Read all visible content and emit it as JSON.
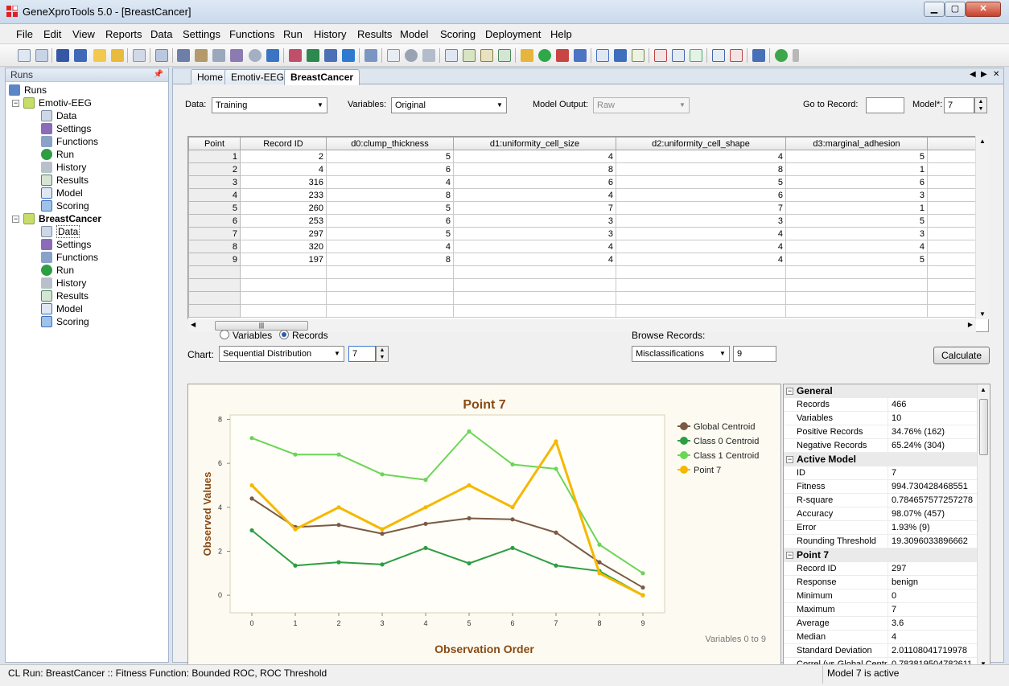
{
  "window": {
    "title": "GeneXproTools 5.0 - [BreastCancer]",
    "min_glyph": "▁",
    "max_glyph": "▢",
    "close_glyph": "✕"
  },
  "menu": [
    "File",
    "Edit",
    "View",
    "Reports",
    "Data",
    "Settings",
    "Functions",
    "Run",
    "History",
    "Results",
    "Model",
    "Scoring",
    "Deployment",
    "Help"
  ],
  "runs_panel": {
    "header": "Runs",
    "root": "Runs",
    "projects": [
      {
        "name": "Emotiv-EEG",
        "children": [
          "Data",
          "Settings",
          "Functions",
          "Run",
          "History",
          "Results",
          "Model",
          "Scoring"
        ]
      },
      {
        "name": "BreastCancer",
        "children": [
          "Data",
          "Settings",
          "Functions",
          "Run",
          "History",
          "Results",
          "Model",
          "Scoring"
        ]
      }
    ]
  },
  "tabs": [
    "Home",
    "Emotiv-EEG",
    "BreastCancer"
  ],
  "controls": {
    "data_label": "Data:",
    "data_value": "Training",
    "variables_label": "Variables:",
    "variables_value": "Original",
    "model_output_label": "Model Output:",
    "model_output_value": "Raw",
    "goto_label": "Go to Record:",
    "goto_value": "",
    "model_label": "Model*:",
    "model_value": "7"
  },
  "grid": {
    "columns": [
      "Point",
      "Record ID",
      "d0:clump_thickness",
      "d1:uniformity_cell_size",
      "d2:uniformity_cell_shape",
      "d3:marginal_adhesion"
    ],
    "rows": [
      [
        "1",
        "2",
        "5",
        "4",
        "4",
        "5"
      ],
      [
        "2",
        "4",
        "6",
        "8",
        "8",
        "1"
      ],
      [
        "3",
        "316",
        "4",
        "6",
        "5",
        "6"
      ],
      [
        "4",
        "233",
        "8",
        "4",
        "6",
        "3"
      ],
      [
        "5",
        "260",
        "5",
        "7",
        "7",
        "1"
      ],
      [
        "6",
        "253",
        "6",
        "3",
        "3",
        "5"
      ],
      [
        "7",
        "297",
        "5",
        "3",
        "4",
        "3"
      ],
      [
        "8",
        "320",
        "4",
        "4",
        "4",
        "4"
      ],
      [
        "9",
        "197",
        "8",
        "4",
        "4",
        "5"
      ]
    ],
    "empty_rows": 4
  },
  "chart_controls": {
    "radio_variables": "Variables",
    "radio_records": "Records",
    "chart_label": "Chart:",
    "chart_value": "Sequential Distribution",
    "chart_spin_value": "7",
    "browse_label": "Browse Records:",
    "browse_value": "Misclassifications",
    "browse_count": "9",
    "calculate": "Calculate"
  },
  "chart_data": {
    "type": "line",
    "title": "Point 7",
    "xlabel": "Observation Order",
    "ylabel": "Observed Values",
    "note": "Variables 0 to 9",
    "x": [
      0,
      1,
      2,
      3,
      4,
      5,
      6,
      7,
      8,
      9
    ],
    "xlim": [
      -0.5,
      9.5
    ],
    "ylim": [
      -0.8,
      8.2
    ],
    "yticks": [
      0,
      2,
      4,
      6,
      8
    ],
    "legend": "right",
    "series": [
      {
        "name": "Global Centroid",
        "color": "#7a5a45",
        "width": 2,
        "values": [
          4.4,
          3.1,
          3.2,
          2.8,
          3.25,
          3.5,
          3.45,
          2.85,
          1.5,
          0.35
        ]
      },
      {
        "name": "Class 0 Centroid",
        "color": "#2e9e44",
        "width": 2,
        "values": [
          2.95,
          1.35,
          1.5,
          1.4,
          2.15,
          1.45,
          2.15,
          1.35,
          1.1,
          0.0
        ]
      },
      {
        "name": "Class 1 Centroid",
        "color": "#6ad655",
        "width": 2,
        "values": [
          7.15,
          6.4,
          6.4,
          5.5,
          5.25,
          7.45,
          5.95,
          5.75,
          2.3,
          1.0
        ]
      },
      {
        "name": "Point 7",
        "color": "#f5b800",
        "width": 3,
        "values": [
          5,
          3,
          4,
          3,
          4,
          5,
          4,
          7,
          1,
          0
        ]
      }
    ]
  },
  "properties": [
    {
      "category": "General",
      "items": [
        [
          "Records",
          "466"
        ],
        [
          "Variables",
          "10"
        ],
        [
          "Positive Records",
          "34.76% (162)"
        ],
        [
          "Negative Records",
          "65.24% (304)"
        ]
      ]
    },
    {
      "category": "Active Model",
      "items": [
        [
          "ID",
          "7"
        ],
        [
          "Fitness",
          "994.730428468551"
        ],
        [
          "R-square",
          "0.784657577257278"
        ],
        [
          "Accuracy",
          "98.07% (457)"
        ],
        [
          "Error",
          "1.93% (9)"
        ],
        [
          "Rounding Threshold",
          "19.3096033896662"
        ]
      ]
    },
    {
      "category": "Point 7",
      "items": [
        [
          "Record ID",
          "297"
        ],
        [
          "Response",
          "benign"
        ],
        [
          "Minimum",
          "0"
        ],
        [
          "Maximum",
          "7"
        ],
        [
          "Average",
          "3.6"
        ],
        [
          "Median",
          "4"
        ],
        [
          "Standard Deviation",
          "2.01108041719978"
        ],
        [
          "Correl (vs Global Centroid)",
          "0.783819504782611"
        ]
      ]
    }
  ],
  "status": {
    "left": "CL Run: BreastCancer :: Fitness Function: Bounded ROC, ROC Threshold",
    "right": "Model 7 is active"
  }
}
